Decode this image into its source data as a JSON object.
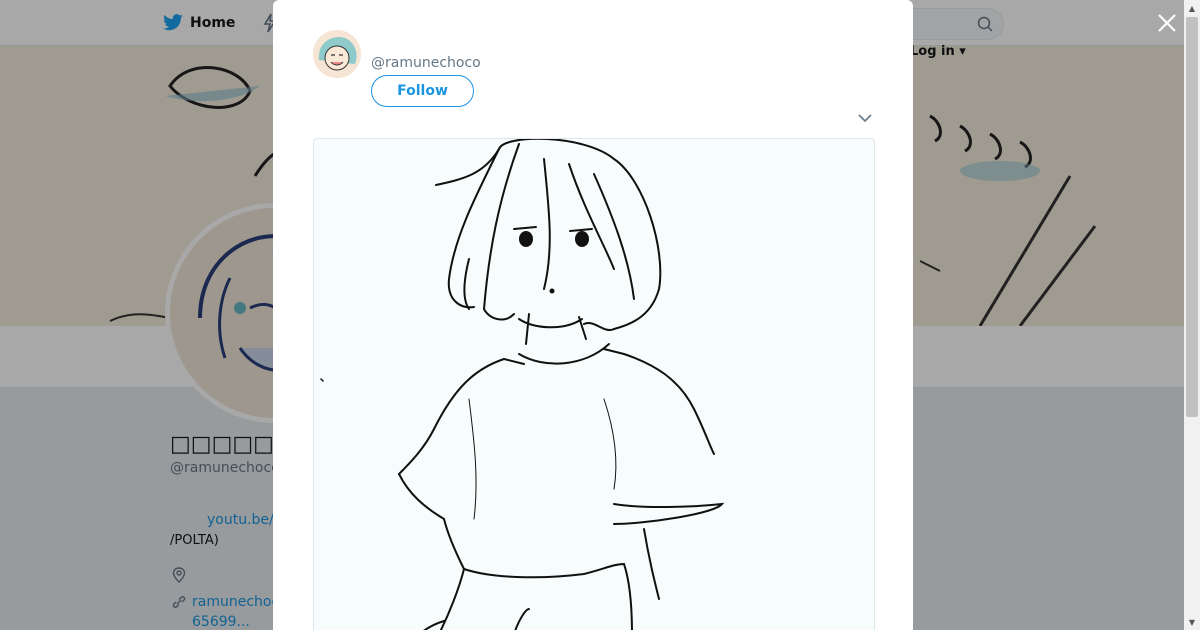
{
  "nav": {
    "home_label": "Home",
    "login_label": "Log in"
  },
  "profile": {
    "name": "□□□□□□□",
    "handle": "@ramunechoco",
    "bio_link": "youtu.be/",
    "bio_text": "/POLTA)",
    "url_line1": "ramunechoc",
    "url_line2": "65699..."
  },
  "tweet": {
    "handle": "@ramunechoco",
    "follow_label": "Follow"
  },
  "colors": {
    "accent": "#1b95e0",
    "overlay": "rgba(0,0,0,0.34)"
  },
  "icons": {
    "home": "twitter-bird-icon",
    "search": "search-icon",
    "close": "close-icon",
    "chevron": "chevron-down-icon",
    "location": "location-pin-icon",
    "link": "link-icon"
  }
}
